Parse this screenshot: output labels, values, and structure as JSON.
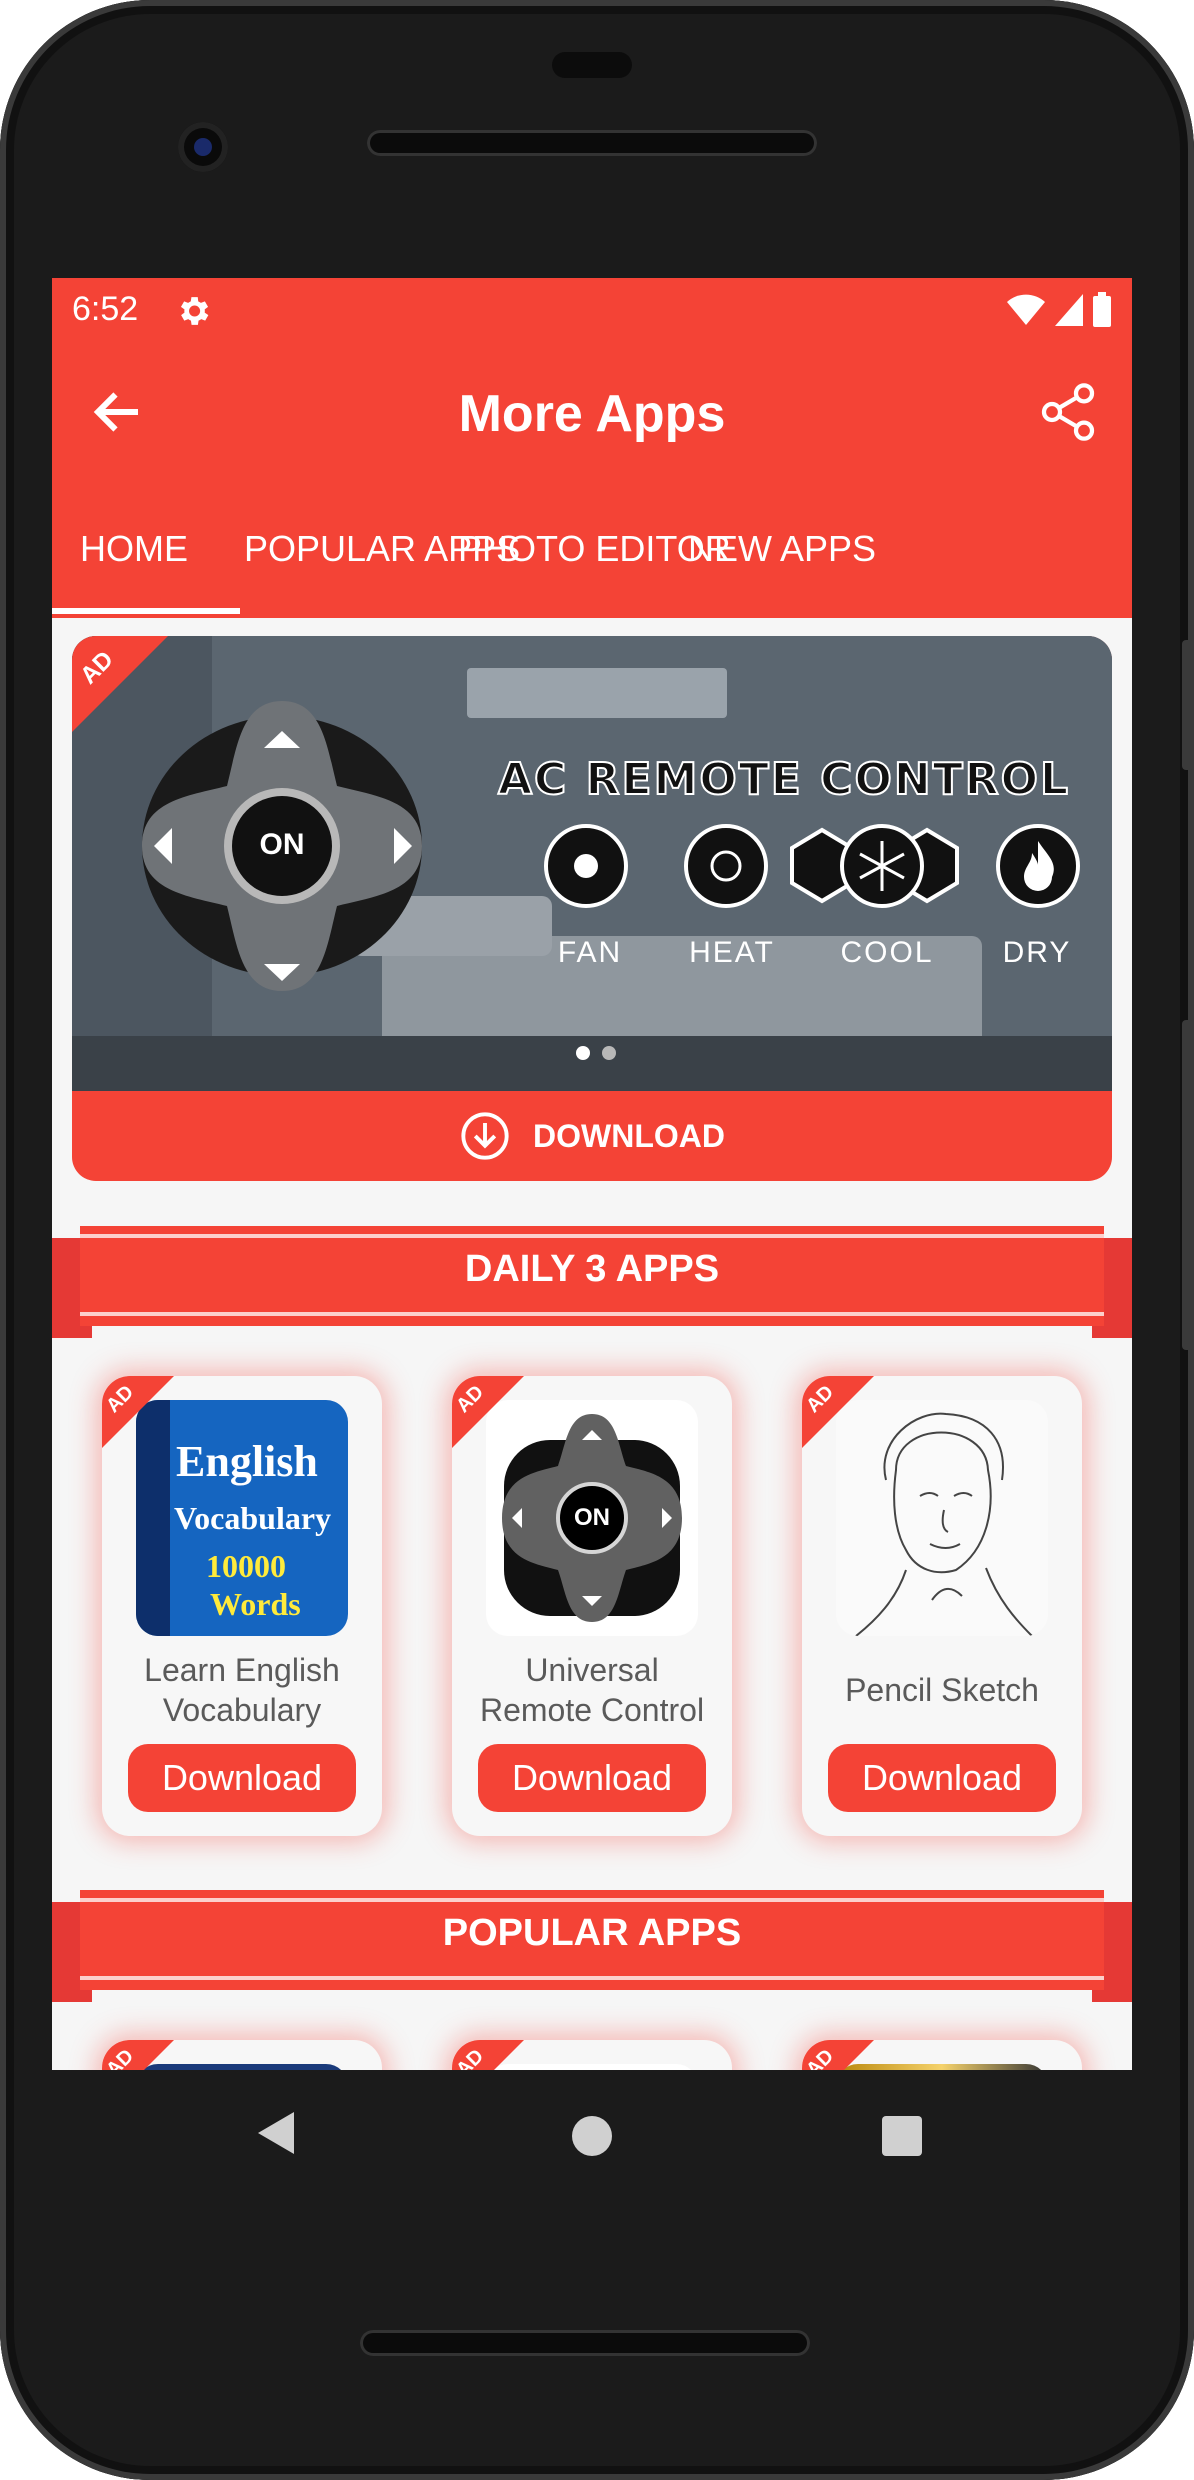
{
  "status_bar": {
    "time": "6:52"
  },
  "app_bar": {
    "title": "More Apps"
  },
  "tabs": [
    {
      "label": "HOME",
      "active": true
    },
    {
      "label": "POPULAR APPS",
      "active": false
    },
    {
      "label": "PHOTO EDITOR",
      "active": false
    },
    {
      "label": "NEW APPS",
      "active": false
    }
  ],
  "banner": {
    "ad_label": "AD",
    "headline": "AC REMOTE CONTROL",
    "center_button": "ON",
    "modes": [
      "FAN",
      "HEAT",
      "COOL",
      "DRY"
    ],
    "download_label": "DOWNLOAD",
    "page_index": 1,
    "page_count": 2
  },
  "daily_section": {
    "title": "DAILY 3 APPS",
    "apps": [
      {
        "name_line1": "Learn English",
        "name_line2": "Vocabulary",
        "button": "Download",
        "ad": "AD",
        "thumb_text": [
          "English",
          "Vocabulary",
          "10000",
          "Words"
        ]
      },
      {
        "name_line1": "Universal",
        "name_line2": "Remote Control",
        "button": "Download",
        "ad": "AD",
        "thumb_text": [
          "ON"
        ]
      },
      {
        "name_line1": "Pencil Sketch",
        "name_line2": "",
        "button": "Download",
        "ad": "AD"
      }
    ]
  },
  "popular_section": {
    "title": "POPULAR APPS",
    "ad": "AD"
  },
  "colors": {
    "primary": "#f44336",
    "card_bg": "#f7f7f7",
    "text_grey": "#5a5a5a"
  }
}
